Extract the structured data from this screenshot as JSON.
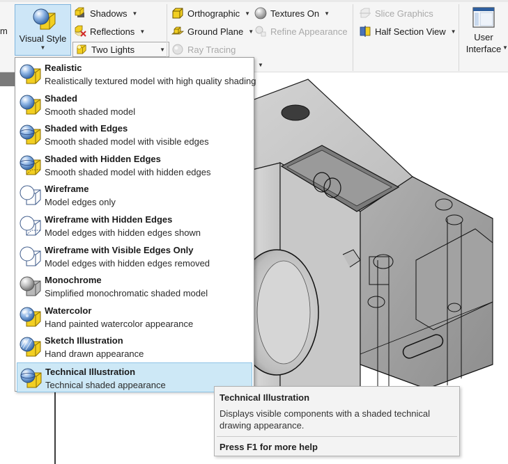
{
  "ribbon": {
    "left_fragment": "m",
    "visual_style": {
      "label": "Visual Style",
      "caret": "▼",
      "icon": "visual-style-icon"
    },
    "shadows": {
      "label": "Shadows",
      "icon": "shadows-icon"
    },
    "reflections": {
      "label": "Reflections",
      "icon": "reflections-icon"
    },
    "lights": {
      "value": "Two Lights",
      "icon": "light-bulb-icon"
    },
    "orthographic": {
      "label": "Orthographic",
      "icon": "orthographic-cube-icon"
    },
    "ground_plane": {
      "label": "Ground Plane",
      "icon": "ground-plane-icon"
    },
    "ray_tracing": {
      "label": "Ray Tracing",
      "disabled": true,
      "icon": "ray-tracing-icon"
    },
    "textures_on": {
      "label": "Textures On",
      "icon": "textures-sphere-icon"
    },
    "refine_appearance": {
      "label": "Refine Appearance",
      "disabled": true,
      "icon": "refine-appearance-icon"
    },
    "slice_graphics": {
      "label": "Slice Graphics",
      "disabled": true,
      "icon": "slice-graphics-icon"
    },
    "half_section_view": {
      "label": "Half Section View",
      "icon": "half-section-icon"
    },
    "user_interface": {
      "line1": "User",
      "line2": "Interface",
      "icon": "user-interface-window-icon"
    },
    "dropdown_caret": "▼"
  },
  "menu": {
    "items": [
      {
        "title": "Realistic",
        "desc": "Realistically textured model with high quality shading",
        "icon": "realistic-style-icon"
      },
      {
        "title": "Shaded",
        "desc": "Smooth shaded model",
        "icon": "shaded-style-icon"
      },
      {
        "title": "Shaded with Edges",
        "desc": "Smooth shaded model with visible edges",
        "icon": "shaded-edges-style-icon"
      },
      {
        "title": "Shaded with Hidden Edges",
        "desc": "Smooth shaded model with hidden edges",
        "icon": "shaded-hidden-edges-style-icon"
      },
      {
        "title": "Wireframe",
        "desc": "Model edges only",
        "icon": "wireframe-style-icon"
      },
      {
        "title": "Wireframe with Hidden Edges",
        "desc": "Model edges with hidden edges shown",
        "icon": "wireframe-hidden-edges-style-icon"
      },
      {
        "title": "Wireframe with Visible Edges Only",
        "desc": "Model edges with hidden edges removed",
        "icon": "wireframe-visible-edges-style-icon"
      },
      {
        "title": "Monochrome",
        "desc": "Simplified monochromatic shaded model",
        "icon": "monochrome-style-icon"
      },
      {
        "title": "Watercolor",
        "desc": "Hand painted watercolor appearance",
        "icon": "watercolor-style-icon"
      },
      {
        "title": "Sketch Illustration",
        "desc": "Hand drawn appearance",
        "icon": "sketch-style-icon"
      },
      {
        "title": "Technical Illustration",
        "desc": "Technical shaded appearance",
        "icon": "technical-style-icon"
      }
    ],
    "selected_index": 10
  },
  "tooltip": {
    "title": "Technical Illustration",
    "desc": "Displays visible components with a shaded technical drawing appearance.",
    "help": "Press F1 for more help"
  },
  "colors": {
    "ribbon_bg": "#f5f5f5",
    "selection_bg": "#cde8f6",
    "selection_border": "#8fc4e6",
    "menu_border": "#9a9a9a",
    "cube_yellow": "#f2cf22",
    "sphere_blue": "#4f84c4",
    "disabled_text": "#a9a9a9",
    "model_gray": "#b5b5b5"
  }
}
